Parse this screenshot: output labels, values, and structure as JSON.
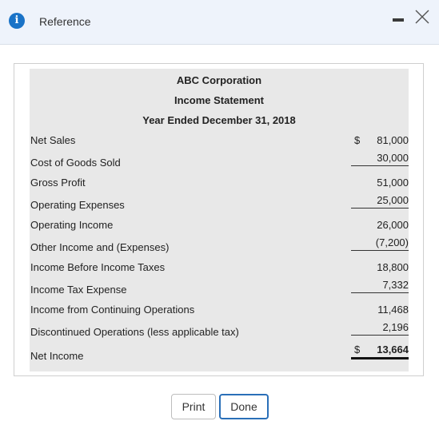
{
  "dialog": {
    "title": "Reference",
    "icon": "info-icon",
    "accent": "#1a73c7"
  },
  "statement": {
    "company": "ABC Corporation",
    "title": "Income Statement",
    "period": "Year Ended December 31, 2018",
    "currency_symbol": "$",
    "rows": [
      {
        "label": "Net Sales",
        "amount": "81,000"
      },
      {
        "label": "Cost of Goods Sold",
        "amount": "30,000"
      },
      {
        "label": "Gross Profit",
        "amount": "51,000"
      },
      {
        "label": "Operating Expenses",
        "amount": "25,000"
      },
      {
        "label": "Operating Income",
        "amount": "26,000"
      },
      {
        "label": "Other Income and (Expenses)",
        "amount": "(7,200)"
      },
      {
        "label": "Income Before Income Taxes",
        "amount": "18,800"
      },
      {
        "label": "Income Tax Expense",
        "amount": "7,332"
      },
      {
        "label": "Income from Continuing Operations",
        "amount": "11,468"
      },
      {
        "label": "Discontinued Operations (less applicable tax)",
        "amount": "2,196"
      },
      {
        "label": "Net Income",
        "amount": "13,664"
      }
    ]
  },
  "buttons": {
    "print": "Print",
    "done": "Done"
  }
}
